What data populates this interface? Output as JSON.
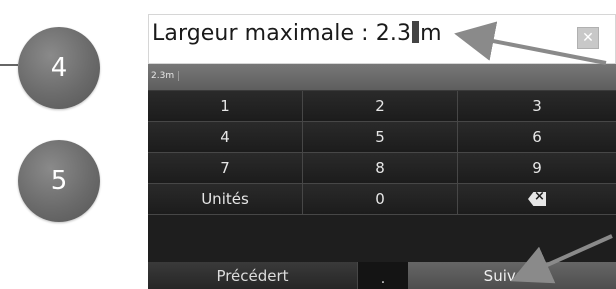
{
  "callouts": [
    {
      "number": "4"
    },
    {
      "number": "5"
    }
  ],
  "entry": {
    "label": "Largeur maximale",
    "separator": " : ",
    "value_before_caret": "2.3",
    "value_after_caret": "m",
    "close_icon": "close-icon"
  },
  "preview": {
    "text": "2.3m"
  },
  "keypad": {
    "keys": [
      "1",
      "2",
      "3",
      "4",
      "5",
      "6",
      "7",
      "8",
      "9",
      "Unités",
      "0",
      "backspace-icon"
    ]
  },
  "bottom": {
    "previous_label": "Précédert",
    "decimal_label": ".",
    "next_label": "Suivant"
  },
  "colors": {
    "panel_bg": "#1e1e1e",
    "key_text": "#e6e6e6",
    "next_bg": "#5a5a5a",
    "callout_bg": "#6b6b6b"
  }
}
